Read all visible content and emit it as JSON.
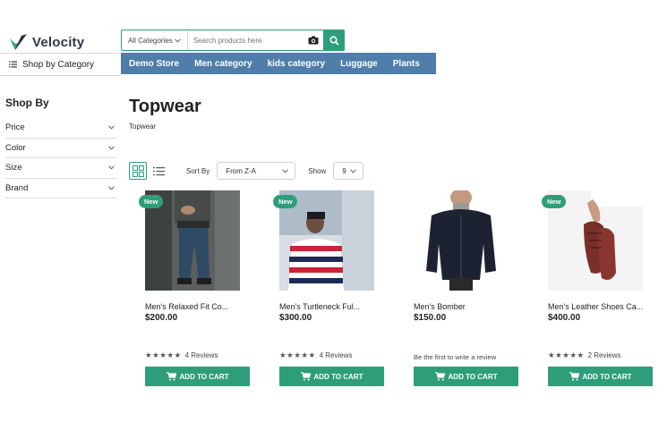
{
  "brand": {
    "name": "Velocity"
  },
  "search": {
    "category_label": "All Categories",
    "placeholder": "Search products here"
  },
  "header": {
    "shop_by_category": "Shop by Category"
  },
  "nav": [
    "Demo Store",
    "Men category",
    "kids category",
    "Luggage",
    "Plants"
  ],
  "sidebar": {
    "title": "Shop By",
    "filters": [
      "Price",
      "Color",
      "Size",
      "Brand"
    ]
  },
  "page": {
    "title": "Topwear",
    "breadcrumb": "Topwear"
  },
  "toolbar": {
    "sort_label": "Sort By",
    "sort_value": "From Z-A",
    "show_label": "Show",
    "show_value": "9"
  },
  "products": [
    {
      "badge": "New",
      "name": "Men's Relaxed Fit Co...",
      "price": "$200.00",
      "rating_stars": 5,
      "review_text": "4 Reviews",
      "cart_label": "ADD TO CART"
    },
    {
      "badge": "New",
      "name": "Men's Turtleneck Ful...",
      "price": "$300.00",
      "rating_stars": 5,
      "review_text": "4 Reviews",
      "cart_label": "ADD TO CART"
    },
    {
      "badge": "",
      "name": "Men's Bomber",
      "price": "$150.00",
      "rating_stars": 0,
      "review_text": "Be the first to write a review",
      "cart_label": "ADD TO CART"
    },
    {
      "badge": "New",
      "name": "Men's Leather Shoes Ca...",
      "price": "$400.00",
      "rating_stars": 5,
      "review_text": "2 Reviews",
      "cart_label": "ADD TO CART"
    }
  ],
  "colors": {
    "accent": "#2e9e7a",
    "nav_bg": "#4e7ea9"
  }
}
